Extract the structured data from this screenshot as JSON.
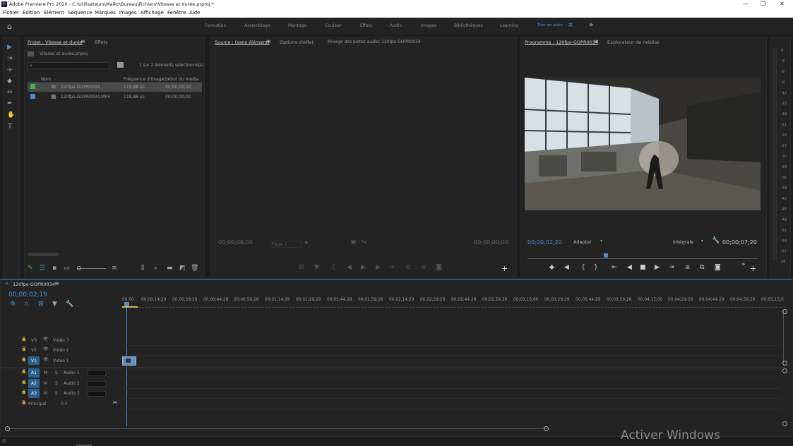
{
  "titlebar": {
    "title": "Adobe Premiere Pro 2020 - C:\\Utilisateurs\\Malko\\Bureau\\Fichiers\\Vitesse et durée.prproj *",
    "min": "—",
    "max": "❐",
    "close": "✕"
  },
  "menubar": [
    "Fichier",
    "Edition",
    "Elément",
    "Séquence",
    "Marques",
    "Images",
    "Affichage",
    "Fenêtre",
    "Aide"
  ],
  "workspaces": {
    "items": [
      "Formation",
      "Assemblage",
      "Montage",
      "Couleur",
      "Effets",
      "Audio",
      "Images",
      "Bibliothèques",
      "Learning",
      "Trier en piste"
    ],
    "active": "Trier en piste",
    "more": "»"
  },
  "project": {
    "tab": "Projet : Vitesse et durée",
    "tab2": "Effets",
    "file": "Vitesse et durée.prproj",
    "search_placeholder": "",
    "selection": "1 sur 2 éléments sélectionné(s)",
    "columns": [
      "Nom",
      "Fréquence d'image",
      "Début du média"
    ],
    "rows": [
      {
        "name": "120fps-GOPR0034",
        "fps": "119,88 i/s",
        "start": "00;00;00;00",
        "color": "#3fb64a"
      },
      {
        "name": "120fps-GOPR0034.MP4",
        "fps": "119,88 i/s",
        "start": "00;00;00;00",
        "color": "#4f8fd6"
      }
    ]
  },
  "source": {
    "tab": "Source : (sans élément)",
    "tab2": "Options d'effet",
    "tab3": "Mixage des pistes audio: 120fps-GOPR0034",
    "tc_left": "00;00;00;00",
    "page": "Page 1",
    "tc_right": "00;00;00;00"
  },
  "program": {
    "tab": "Programme : 120fps-GOPR0034",
    "tab2": "Explorateur de médias",
    "tc_left": "00;00;02;20",
    "fit": "Adapter",
    "quality": "Intégrale",
    "tc_right": "00;00;07;20"
  },
  "timeline": {
    "tab": "120fps-GOPR0034",
    "tc": "00;00;02;19",
    "ruler": [
      "00;00",
      "00;00;14;29",
      "00;00;29;29",
      "00;00;44;28",
      "00;00;59;28",
      "00;01;14;29",
      "00;01;29;29",
      "00;01;44;28",
      "00;01;59;28",
      "00;02;14;29",
      "00;02;29;29",
      "00;02;44;29",
      "00;02;59;28",
      "00;03;15;00",
      "00;03;29;29",
      "00;03;44;29",
      "00;03;59;28",
      "00;04;15;00",
      "00;04;29;29",
      "00;04;44;29",
      "00;04;59;29",
      "00;05;15;0"
    ],
    "video_tracks": [
      {
        "id": "V3",
        "name": "Vidéo 3"
      },
      {
        "id": "V2",
        "name": "Vidéo 2"
      },
      {
        "id": "V1",
        "name": "Vidéo 1"
      }
    ],
    "audio_tracks": [
      {
        "id": "A1",
        "name": "Audio 1"
      },
      {
        "id": "A2",
        "name": "Audio 2"
      },
      {
        "id": "A3",
        "name": "Audio 3"
      }
    ],
    "master": {
      "name": "Principal",
      "value": "0,0"
    }
  },
  "meter_labels": [
    "0",
    "-3",
    "-6",
    "-9",
    "-12",
    "-15",
    "-18",
    "-21",
    "-24",
    "-27",
    "-30",
    "-33",
    "-36",
    "-39",
    "-42",
    "-45",
    "-48",
    "-51",
    "-54",
    "-57",
    "dB"
  ],
  "watermark": "Activer Windows",
  "colors": {
    "accent": "#4f8fd6",
    "clip": "#6c8fc7"
  }
}
